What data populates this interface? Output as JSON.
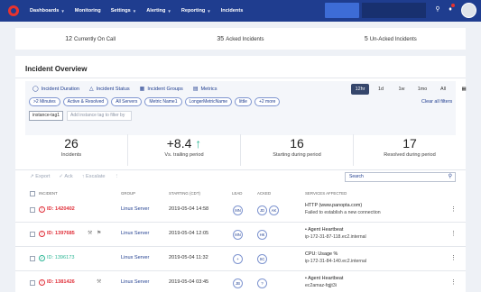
{
  "nav": {
    "items": [
      {
        "label": "Dashboards",
        "chevron": true
      },
      {
        "label": "Monitoring",
        "chevron": false
      },
      {
        "label": "Settings",
        "chevron": true
      },
      {
        "label": "Alerting",
        "chevron": true
      },
      {
        "label": "Reporting",
        "chevron": true
      },
      {
        "label": "Incidents",
        "chevron": false
      }
    ],
    "icons": [
      "search-icon",
      "bell-icon",
      "user-avatar"
    ]
  },
  "stats": [
    {
      "number": "12",
      "label": "Currently On Call"
    },
    {
      "number": "35",
      "label": "Acked Incidents"
    },
    {
      "number": "5",
      "label": "Un-Acked Incidents"
    }
  ],
  "overview": {
    "title": "Incident Overview",
    "tabs": [
      {
        "label": "Incident Duration",
        "icon": "shield-icon"
      },
      {
        "label": "Incident Status",
        "icon": "warning-icon"
      },
      {
        "label": "Incident Groups",
        "icon": "grid-icon"
      },
      {
        "label": "Metrics",
        "icon": "chart-icon"
      }
    ],
    "ranges": [
      "12hr",
      "1d",
      "1w",
      "1mo",
      "All"
    ],
    "active_range": "12hr",
    "chips": [
      ">2 Minutes",
      "Active & Resolved",
      "All Servers",
      "Metric Name1",
      "LongerMetricName",
      "little",
      "+2 more"
    ],
    "clear_filters": "Clear all filters",
    "instance_tag": "instance-tag1",
    "instance_placeholder": "Add instance tag to filter by"
  },
  "metrics": [
    {
      "value": "26",
      "label": "Incidents"
    },
    {
      "value": "+8.4",
      "label": "Vs. trailing period",
      "trend": "up"
    },
    {
      "value": "16",
      "label": "Starting during period"
    },
    {
      "value": "17",
      "label": "Resolved during period"
    }
  ],
  "toolbar": {
    "export": "Export",
    "ack": "Ack",
    "escalate": "Escalate",
    "more": "⋮",
    "search_placeholder": "Search"
  },
  "table": {
    "headers": [
      "Incident",
      "Group",
      "Starting (CDT)",
      "Lead",
      "Acked",
      "Services Affected"
    ],
    "rows": [
      {
        "status": "error",
        "id": "ID: 1420402",
        "group": "Linux Server",
        "start": "2019-05-04 14:58",
        "lead": "MN",
        "acked": [
          "JD",
          "AK"
        ],
        "svc_title": "HTTP (www.panopta.com)",
        "svc_detail": "Failed to establish a new connection",
        "extras": []
      },
      {
        "status": "error",
        "id": "ID: 1397685",
        "group": "Linux Server",
        "start": "2019-05-04 12:05",
        "lead": "MN",
        "acked": [
          "HK"
        ],
        "svc_title": "• Agent Heartbeat",
        "svc_detail": "ip-172-31-87-118.ec2.internal",
        "extras": [
          "wrench-icon",
          "flag-icon"
        ]
      },
      {
        "status": "ok",
        "id": "ID: 1396173",
        "group": "Linux Server",
        "start": "2019-05-04 11:32",
        "lead": "+",
        "acked": [
          "SC"
        ],
        "svc_title": "CPU: Usage %",
        "svc_detail": "ip-172-31-84-140.ec2.internal",
        "extras": []
      },
      {
        "status": "error",
        "id": "ID: 1381426",
        "group": "Linux Server",
        "start": "2019-05-04 03:45",
        "lead": "JB",
        "acked": [
          "?"
        ],
        "svc_title": "• Agent Heartbeat",
        "svc_detail": "ec2amaz-fqjjt3i",
        "extras": [
          "wrench-icon"
        ]
      }
    ]
  }
}
